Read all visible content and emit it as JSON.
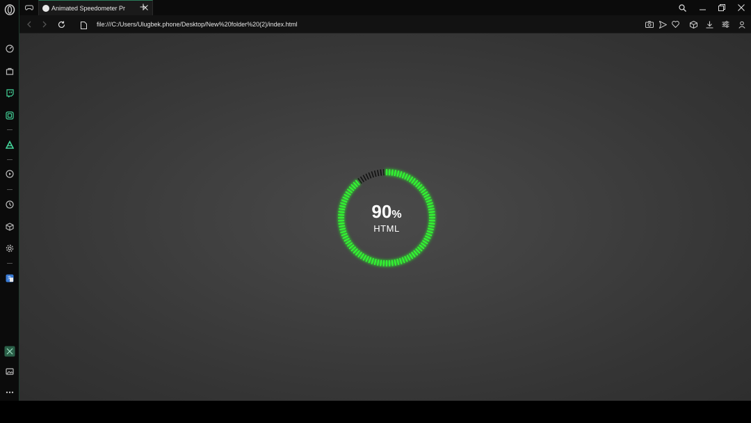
{
  "browser": {
    "tab_title": "Animated Speedometer Pr",
    "url": "file:///C:/Users/Ulugbek.phone/Desktop/New%20folder%20(2)/index.html"
  },
  "icons": {
    "sidebar": [
      "opera-logo-icon",
      "speed-dial-icon",
      "shopping-bag-icon",
      "twitch-icon",
      "gx-control-icon",
      "arcade-icon",
      "player-icon",
      "history-icon",
      "extensions-icon",
      "settings-icon",
      "translator-icon",
      "gx-corner-icon",
      "gallery-icon",
      "more-icon"
    ],
    "toolbar": [
      "screenshot-icon",
      "send-icon",
      "heart-icon",
      "cube-icon",
      "download-icon",
      "easy-setup-icon",
      "account-icon"
    ]
  },
  "colors": {
    "accent": "#2a7d5a",
    "gauge_active": "#33ff33",
    "gauge_inactive": "#111111",
    "background": "#3c3c3c"
  },
  "speedometer": {
    "value": 90,
    "value_text": "90",
    "unit": "%",
    "label": "HTML"
  }
}
